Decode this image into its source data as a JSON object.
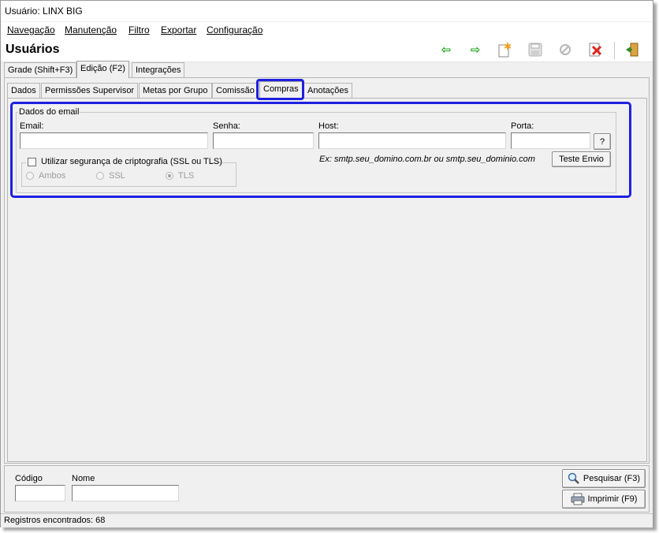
{
  "window": {
    "title": "Usuário: LINX  BIG"
  },
  "menu": {
    "items": [
      "Navegação",
      "Manutenção",
      "Filtro",
      "Exportar",
      "Configuração"
    ]
  },
  "toolbar": {
    "page_title": "Usuários",
    "buttons": [
      {
        "icon": "arrow-left-icon",
        "glyph": "⇦",
        "color": "#1fa31f"
      },
      {
        "icon": "arrow-right-icon",
        "glyph": "⇨",
        "color": "#1fa31f"
      },
      {
        "icon": "new-document-icon",
        "glyph": "✱",
        "color": "#f0a020"
      },
      {
        "icon": "save-icon",
        "glyph": "▣",
        "color": "#b5b5b5"
      },
      {
        "icon": "cancel-icon",
        "glyph": "⊘",
        "color": "#b5b5b5"
      },
      {
        "icon": "delete-icon",
        "glyph": "✖",
        "color": "#e0281e"
      },
      {
        "icon": "exit-icon",
        "glyph": "⇥",
        "color": "#2e8b2e"
      }
    ]
  },
  "main_tabs": [
    "Grade (Shift+F3)",
    "Edição (F2)",
    "Integrações"
  ],
  "main_tab_active": "Edição (F2)",
  "sub_tabs": [
    "Dados",
    "Permissões Supervisor",
    "Metas por Grupo",
    "Comissão",
    "Compras",
    "Anotações"
  ],
  "sub_tab_active": "Compras",
  "email_group": {
    "legend": "Dados do email",
    "email_label": "Email:",
    "email_value": "",
    "senha_label": "Senha:",
    "senha_value": "",
    "host_label": "Host:",
    "host_value": "",
    "porta_label": "Porta:",
    "porta_value": "",
    "help_button": "?",
    "hint": "Ex: smtp.seu_domino.com.br ou smtp.seu_dominio.com",
    "test_button": "Teste Envio",
    "ssl_checkbox_label": "Utilizar segurança de criptografia (SSL ou TLS)",
    "ssl_checked": false,
    "radio_options": [
      "Ambos",
      "SSL",
      "TLS"
    ],
    "radio_selected": "TLS"
  },
  "search": {
    "codigo_label": "Código",
    "codigo_value": "",
    "nome_label": "Nome",
    "nome_value": "",
    "search_button": "Pesquisar (F3)",
    "print_button": "Imprimir (F9)"
  },
  "status": {
    "text": "Registros encontrados: 68"
  }
}
